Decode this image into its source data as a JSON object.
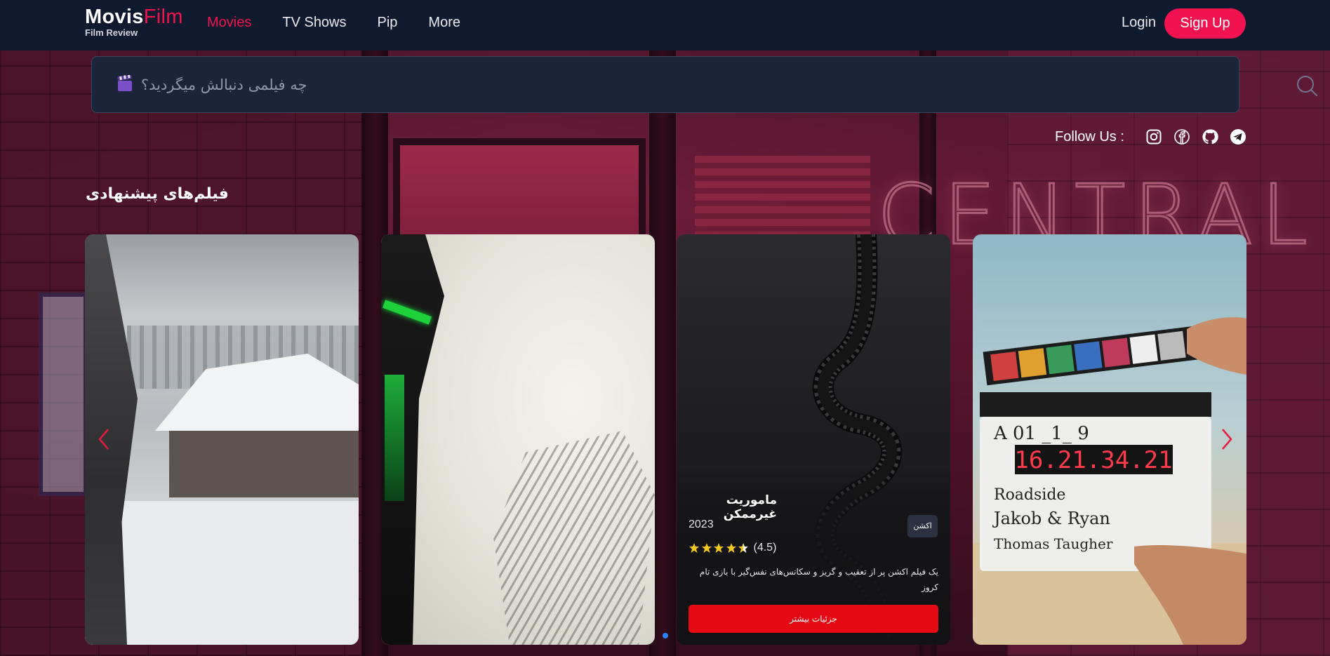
{
  "brand": {
    "name_main": "Movis",
    "name_accent": "Film",
    "tagline": "Film Review",
    "accent_color": "#f0134f"
  },
  "nav": {
    "items": [
      {
        "label": "Movies",
        "active": true
      },
      {
        "label": "TV Shows",
        "active": false
      },
      {
        "label": "Pip",
        "active": false
      },
      {
        "label": "More",
        "active": false
      }
    ],
    "login_label": "Login",
    "signup_label": "Sign Up"
  },
  "search": {
    "placeholder": "چه فیلمی دنبالش میگردید؟",
    "icon": "search-icon",
    "leading_icon": "clapperboard-icon"
  },
  "follow": {
    "label": "Follow Us :",
    "icons": [
      "instagram-icon",
      "facebook-icon",
      "github-icon",
      "telegram-icon"
    ]
  },
  "section": {
    "title": "فیلم‌های پیشنهادی"
  },
  "cards": [
    {
      "art": "snowy-temple"
    },
    {
      "art": "samurai-ink"
    },
    {
      "art": "film-reel",
      "title": "ماموریت غیرممکن",
      "year": "2023",
      "genre": "اکشن",
      "rating": 4.5,
      "rating_text": "(4.5)",
      "description": "یک فیلم اکشن پر از تعقیب و گریز و سکانس‌های نفس‌گیر با بازی تام کروز",
      "button_label": "جزئیات بیشتر",
      "button_color": "#e50914"
    },
    {
      "art": "clapperboard",
      "clapper_text": [
        "A 01 _1_ 9",
        "16.21.34.21",
        "Roadside",
        "Jakob & Ryan",
        "Thomas Taugher"
      ]
    }
  ],
  "carousel": {
    "prev_icon": "chevron-left-icon",
    "next_icon": "chevron-right-icon",
    "dot_color": "#2d7dff"
  }
}
